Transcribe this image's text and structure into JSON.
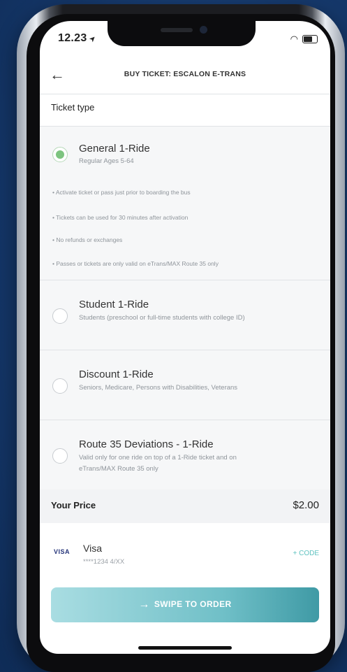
{
  "status": {
    "time": "12.23",
    "location_icon": "location-arrow-icon",
    "wifi_icon": "wifi-icon",
    "battery_icon": "battery-icon"
  },
  "header": {
    "title": "BUY TICKET: ESCALON E-TRANS"
  },
  "ticket_type_label": "Ticket type",
  "options": [
    {
      "title": "General 1-Ride",
      "subtitle": "Regular Ages 5-64",
      "selected": true
    },
    {
      "title": "Student 1-Ride",
      "subtitle": "Students (preschool or full-time students with college ID)",
      "selected": false
    },
    {
      "title": "Discount 1-Ride",
      "subtitle": "Seniors, Medicare, Persons with Disabilities, Veterans",
      "selected": false
    },
    {
      "title": "Route 35 Deviations - 1-Ride",
      "subtitle": "Valid only for one ride on top of a 1-Ride ticket and on eTrans/MAX Route 35 only",
      "selected": false
    }
  ],
  "general_notes": [
    "• Activate ticket or pass just prior to boarding the bus",
    "• Tickets can be used for 30 minutes after activation",
    "• No refunds or exchanges",
    "• Passes or tickets are only valid on eTrans/MAX Route 35 only"
  ],
  "price": {
    "label": "Your Price",
    "value": "$2.00"
  },
  "payment": {
    "logo": "VISA",
    "name": "Visa",
    "number": "****1234 4/XX",
    "code_label": "+ CODE"
  },
  "action": {
    "label": "SWIPE TO ORDER"
  },
  "colors": {
    "accent": "#7dc47f",
    "teal": "#5fc2c0",
    "background": "#163a6e"
  }
}
